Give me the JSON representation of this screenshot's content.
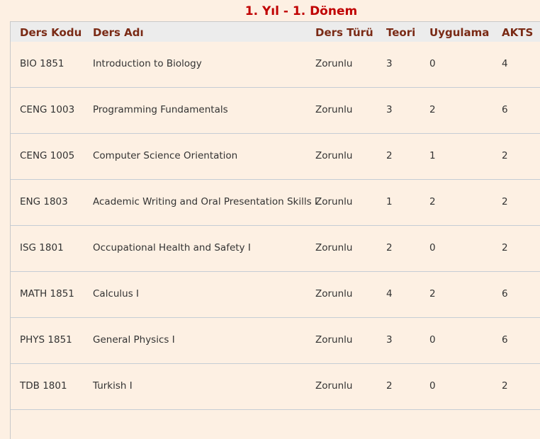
{
  "title": "1. Yıl - 1. Dönem",
  "columns": [
    "Ders Kodu",
    "Ders Adı",
    "Ders Türü",
    "Teori",
    "Uygulama",
    "AKTS"
  ],
  "rows": [
    {
      "code": "BIO 1851",
      "name": "Introduction to Biology",
      "type": "Zorunlu",
      "theory": "3",
      "practice": "0",
      "ects": "4"
    },
    {
      "code": "CENG 1003",
      "name": "Programming Fundamentals",
      "type": "Zorunlu",
      "theory": "3",
      "practice": "2",
      "ects": "6"
    },
    {
      "code": "CENG 1005",
      "name": "Computer Science Orientation",
      "type": "Zorunlu",
      "theory": "2",
      "practice": "1",
      "ects": "2"
    },
    {
      "code": "ENG 1803",
      "name": "Academic Writing and Oral Presentation Skills I",
      "type": "Zorunlu",
      "theory": "1",
      "practice": "2",
      "ects": "2"
    },
    {
      "code": "ISG 1801",
      "name": "Occupational Health and Safety I",
      "type": "Zorunlu",
      "theory": "2",
      "practice": "0",
      "ects": "2"
    },
    {
      "code": "MATH 1851",
      "name": "Calculus I",
      "type": "Zorunlu",
      "theory": "4",
      "practice": "2",
      "ects": "6"
    },
    {
      "code": "PHYS 1851",
      "name": "General Physics I",
      "type": "Zorunlu",
      "theory": "3",
      "practice": "0",
      "ects": "6"
    },
    {
      "code": "TDB 1801",
      "name": "Turkish I",
      "type": "Zorunlu",
      "theory": "2",
      "practice": "0",
      "ects": "2"
    }
  ]
}
